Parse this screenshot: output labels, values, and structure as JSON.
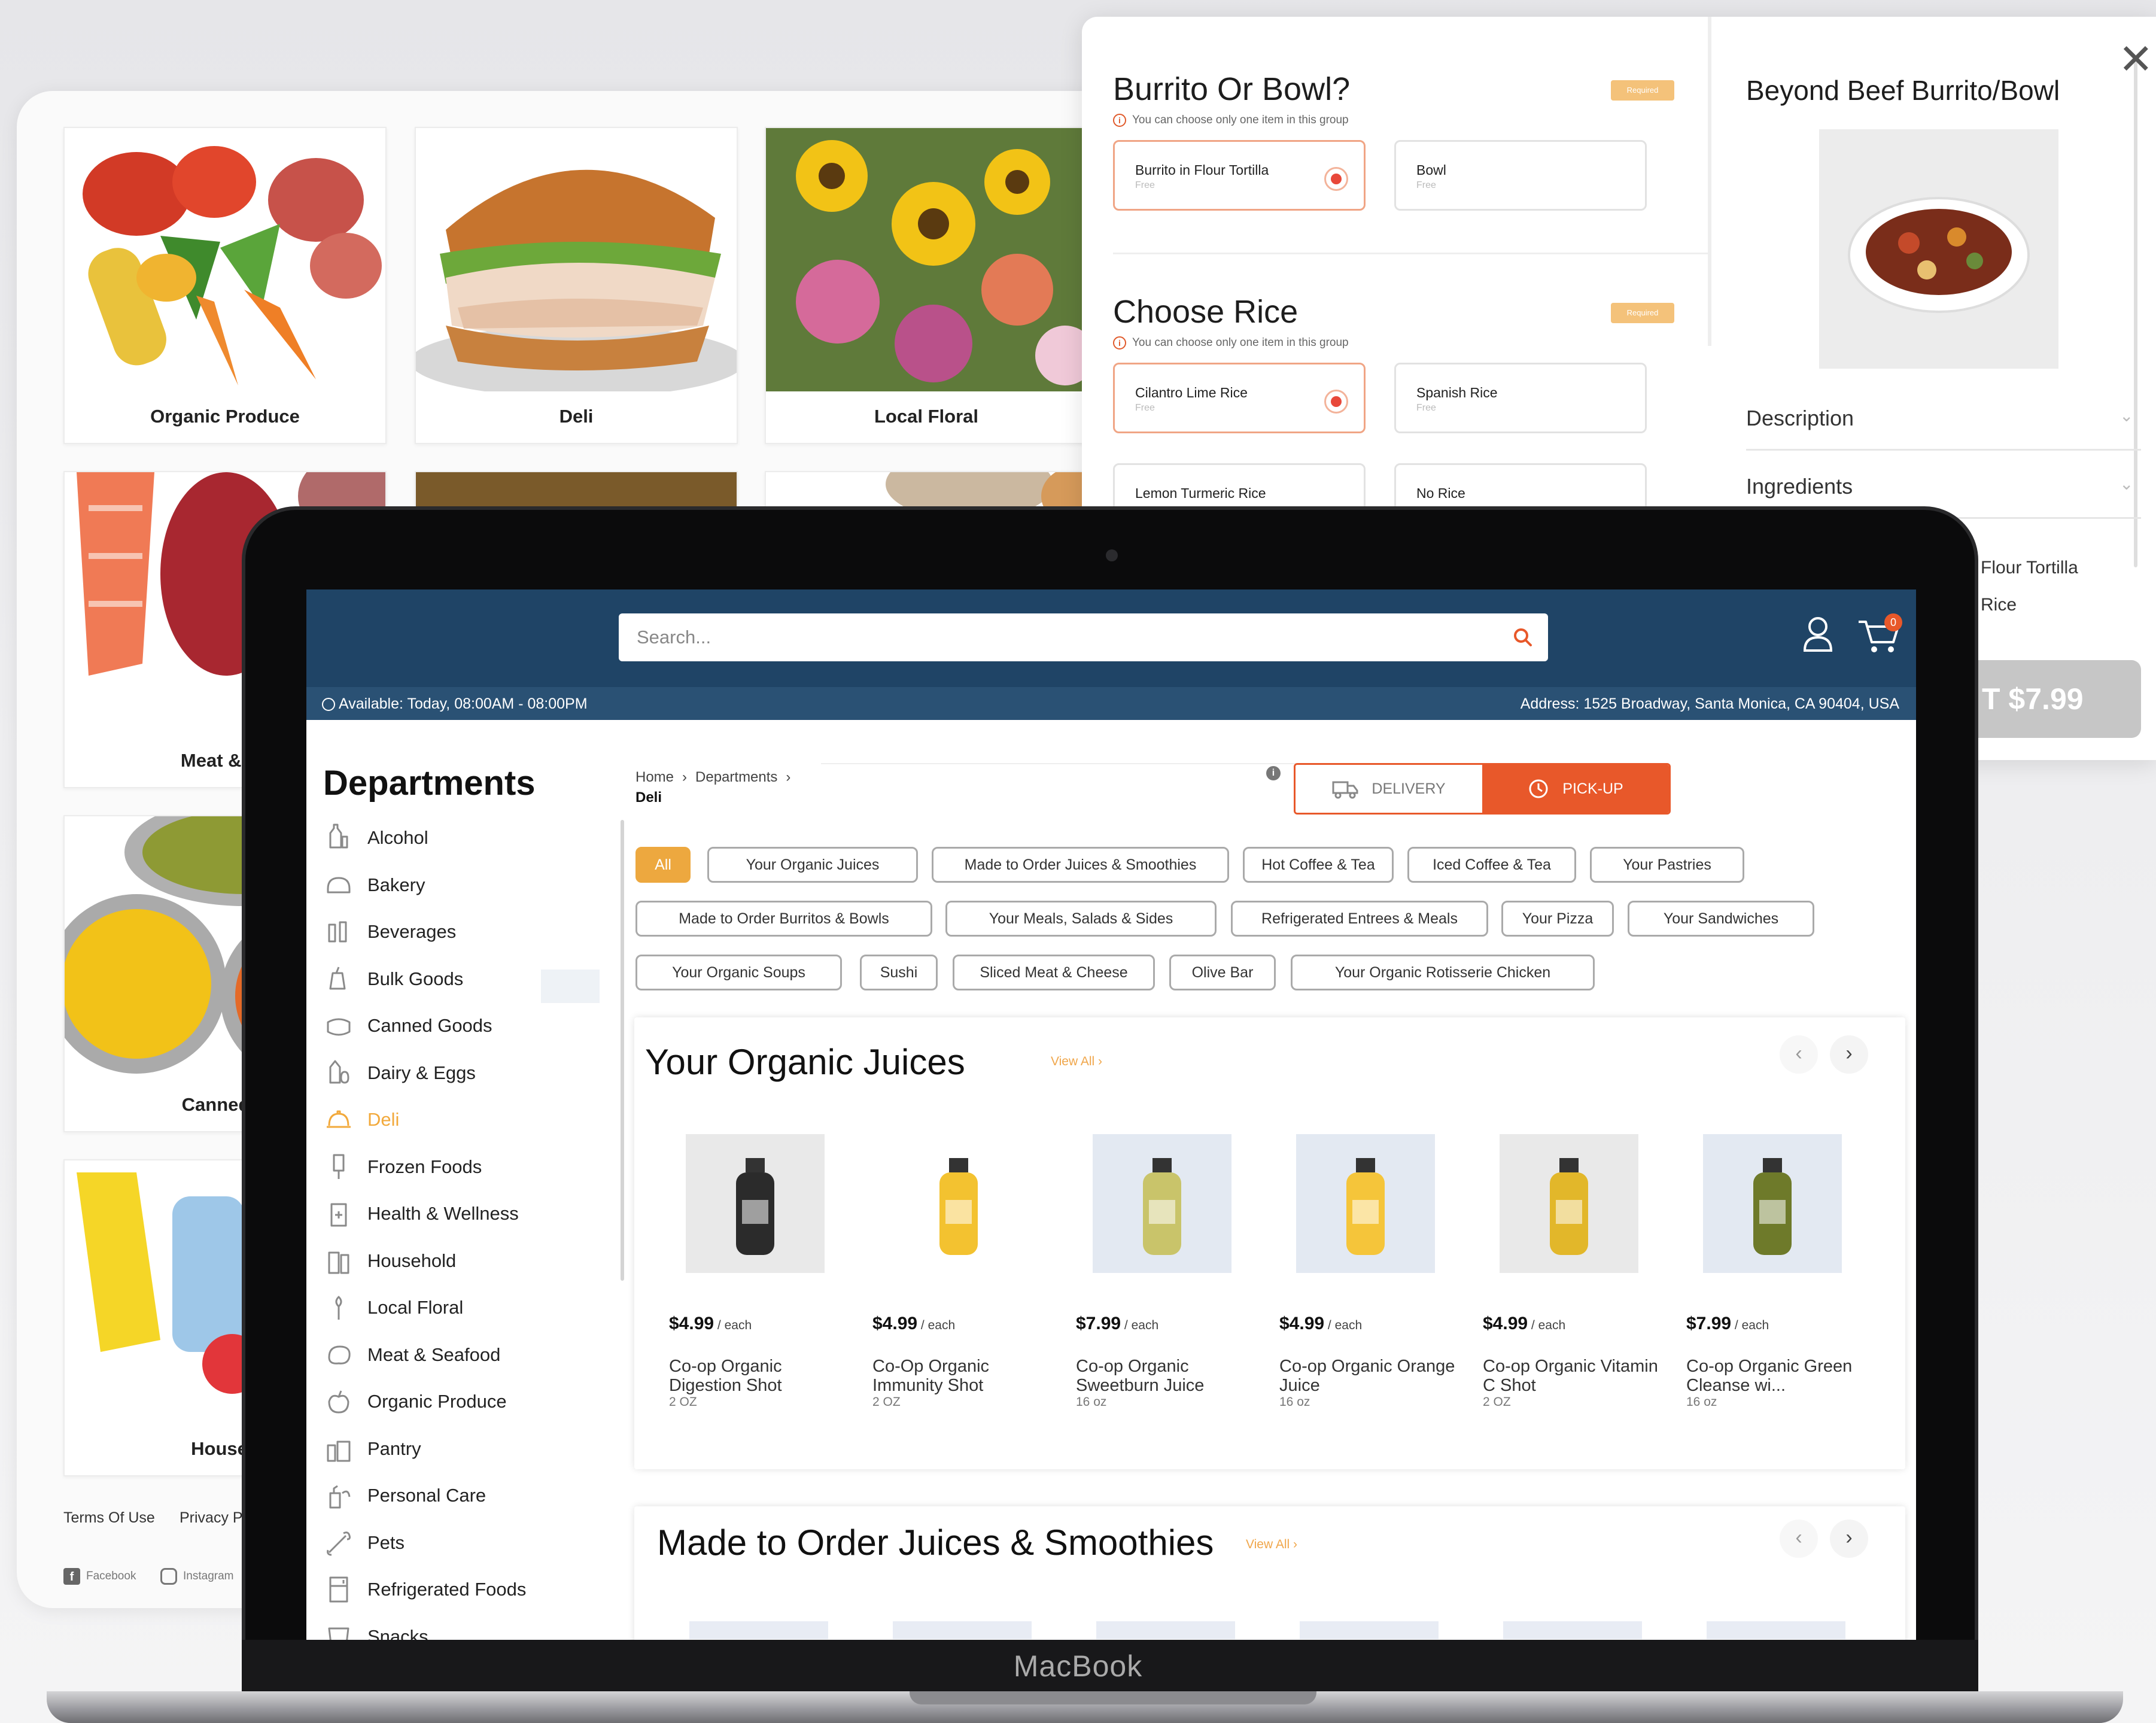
{
  "categories": [
    {
      "label": "Organic Produce"
    },
    {
      "label": "Deli"
    },
    {
      "label": "Local Floral"
    },
    {
      "label": "Meat & Se"
    },
    {
      "label": "Canned C"
    },
    {
      "label": "Househ"
    }
  ],
  "background_footer": {
    "terms": "Terms Of Use",
    "privacy": "Privacy P",
    "facebook": "Facebook",
    "instagram": "Instagram"
  },
  "modal": {
    "group1": {
      "title": "Burrito Or Bowl?",
      "required": "Required",
      "note": "You can choose only one item in this group",
      "options": [
        {
          "name": "Burrito in Flour Tortilla",
          "price": "Free",
          "selected": true
        },
        {
          "name": "Bowl",
          "price": "Free",
          "selected": false
        }
      ]
    },
    "group2": {
      "title": "Choose Rice",
      "required": "Required",
      "note": "You can choose only one item in this group",
      "options": [
        {
          "name": "Cilantro Lime Rice",
          "price": "Free",
          "selected": true
        },
        {
          "name": "Spanish Rice",
          "price": "Free",
          "selected": false
        },
        {
          "name": "Lemon Turmeric Rice",
          "price": "",
          "selected": false
        },
        {
          "name": "No Rice",
          "price": "",
          "selected": false
        }
      ]
    },
    "side": {
      "title": "Beyond Beef Burrito/Bowl",
      "description": "Description",
      "ingredients": "Ingredients",
      "summary_1": "Flour Tortilla",
      "summary_2": "Rice",
      "add_button": "T $7.99"
    }
  },
  "store": {
    "search_placeholder": "Search...",
    "cart_count": "0",
    "availability": "Available: Today, 08:00AM - 08:00PM",
    "address": "Address: 1525 Broadway, Santa Monica, CA 90404, USA",
    "departments_title": "Departments",
    "departments": [
      {
        "label": "Alcohol",
        "icon": "bottles-icon"
      },
      {
        "label": "Bakery",
        "icon": "bread-icon"
      },
      {
        "label": "Beverages",
        "icon": "drinks-icon"
      },
      {
        "label": "Bulk Goods",
        "icon": "scoop-icon"
      },
      {
        "label": "Canned Goods",
        "icon": "can-icon"
      },
      {
        "label": "Dairy & Eggs",
        "icon": "milk-eggs-icon"
      },
      {
        "label": "Deli",
        "icon": "cloche-icon",
        "active": true
      },
      {
        "label": "Frozen Foods",
        "icon": "popsicle-icon"
      },
      {
        "label": "Health & Wellness",
        "icon": "medicine-icon"
      },
      {
        "label": "Household",
        "icon": "cleaning-icon"
      },
      {
        "label": "Local Floral",
        "icon": "flower-icon"
      },
      {
        "label": "Meat & Seafood",
        "icon": "steak-icon"
      },
      {
        "label": "Organic Produce",
        "icon": "apple-icon"
      },
      {
        "label": "Pantry",
        "icon": "jars-icon"
      },
      {
        "label": "Personal Care",
        "icon": "soap-icon"
      },
      {
        "label": "Pets",
        "icon": "bone-icon"
      },
      {
        "label": "Refrigerated Foods",
        "icon": "fridge-icon"
      },
      {
        "label": "Snacks",
        "icon": "chips-icon"
      }
    ],
    "breadcrumb": [
      "Home",
      "Departments"
    ],
    "breadcrumb_current": "Deli",
    "mode": {
      "delivery": "DELIVERY",
      "pickup": "PICK-UP",
      "selected": "pickup"
    },
    "chips": [
      "All",
      "Your Organic Juices",
      "Made to Order Juices & Smoothies",
      "Hot Coffee & Tea",
      "Iced Coffee & Tea",
      "Your Pastries",
      "Made to Order Burritos & Bowls",
      "Your Meals, Salads & Sides",
      "Refrigerated Entrees & Meals",
      "Your Pizza",
      "Your Sandwiches",
      "Your Organic Soups",
      "Sushi",
      "Sliced Meat & Cheese",
      "Olive Bar",
      "Your Organic Rotisserie Chicken"
    ],
    "sections": [
      {
        "title": "Your Organic Juices",
        "view_all": "View All",
        "products": [
          {
            "price": "$4.99",
            "unit": " / each",
            "name": "Co-op Organic Digestion Shot",
            "size": "2 OZ",
            "bottle": "#2b2b2b"
          },
          {
            "price": "$4.99",
            "unit": " / each",
            "name": "Co-Op Organic Immunity Shot",
            "size": "2 OZ",
            "bottle": "#f3c230"
          },
          {
            "price": "$7.99",
            "unit": " / each",
            "name": "Co-op Organic Sweetburn Juice",
            "size": "16 oz",
            "bottle": "#c9c46a"
          },
          {
            "price": "$4.99",
            "unit": " / each",
            "name": "Co-op Organic Orange Juice",
            "size": "16 oz",
            "bottle": "#f5c53a"
          },
          {
            "price": "$4.99",
            "unit": " / each",
            "name": "Co-op Organic Vitamin C Shot",
            "size": "2 OZ",
            "bottle": "#e2b72a"
          },
          {
            "price": "$7.99",
            "unit": " / each",
            "name": "Co-op Organic Green Cleanse wi...",
            "size": "16 oz",
            "bottle": "#6e7a2a"
          }
        ]
      },
      {
        "title": "Made to Order Juices & Smoothies",
        "view_all": "View All"
      }
    ],
    "laptop_brand": "MacBook"
  },
  "colors": {
    "header": "#1f4466",
    "infobar": "#2a5174",
    "accent_orange": "#e8582a",
    "chip_active": "#eda83f",
    "active_department": "#f2a93b"
  }
}
